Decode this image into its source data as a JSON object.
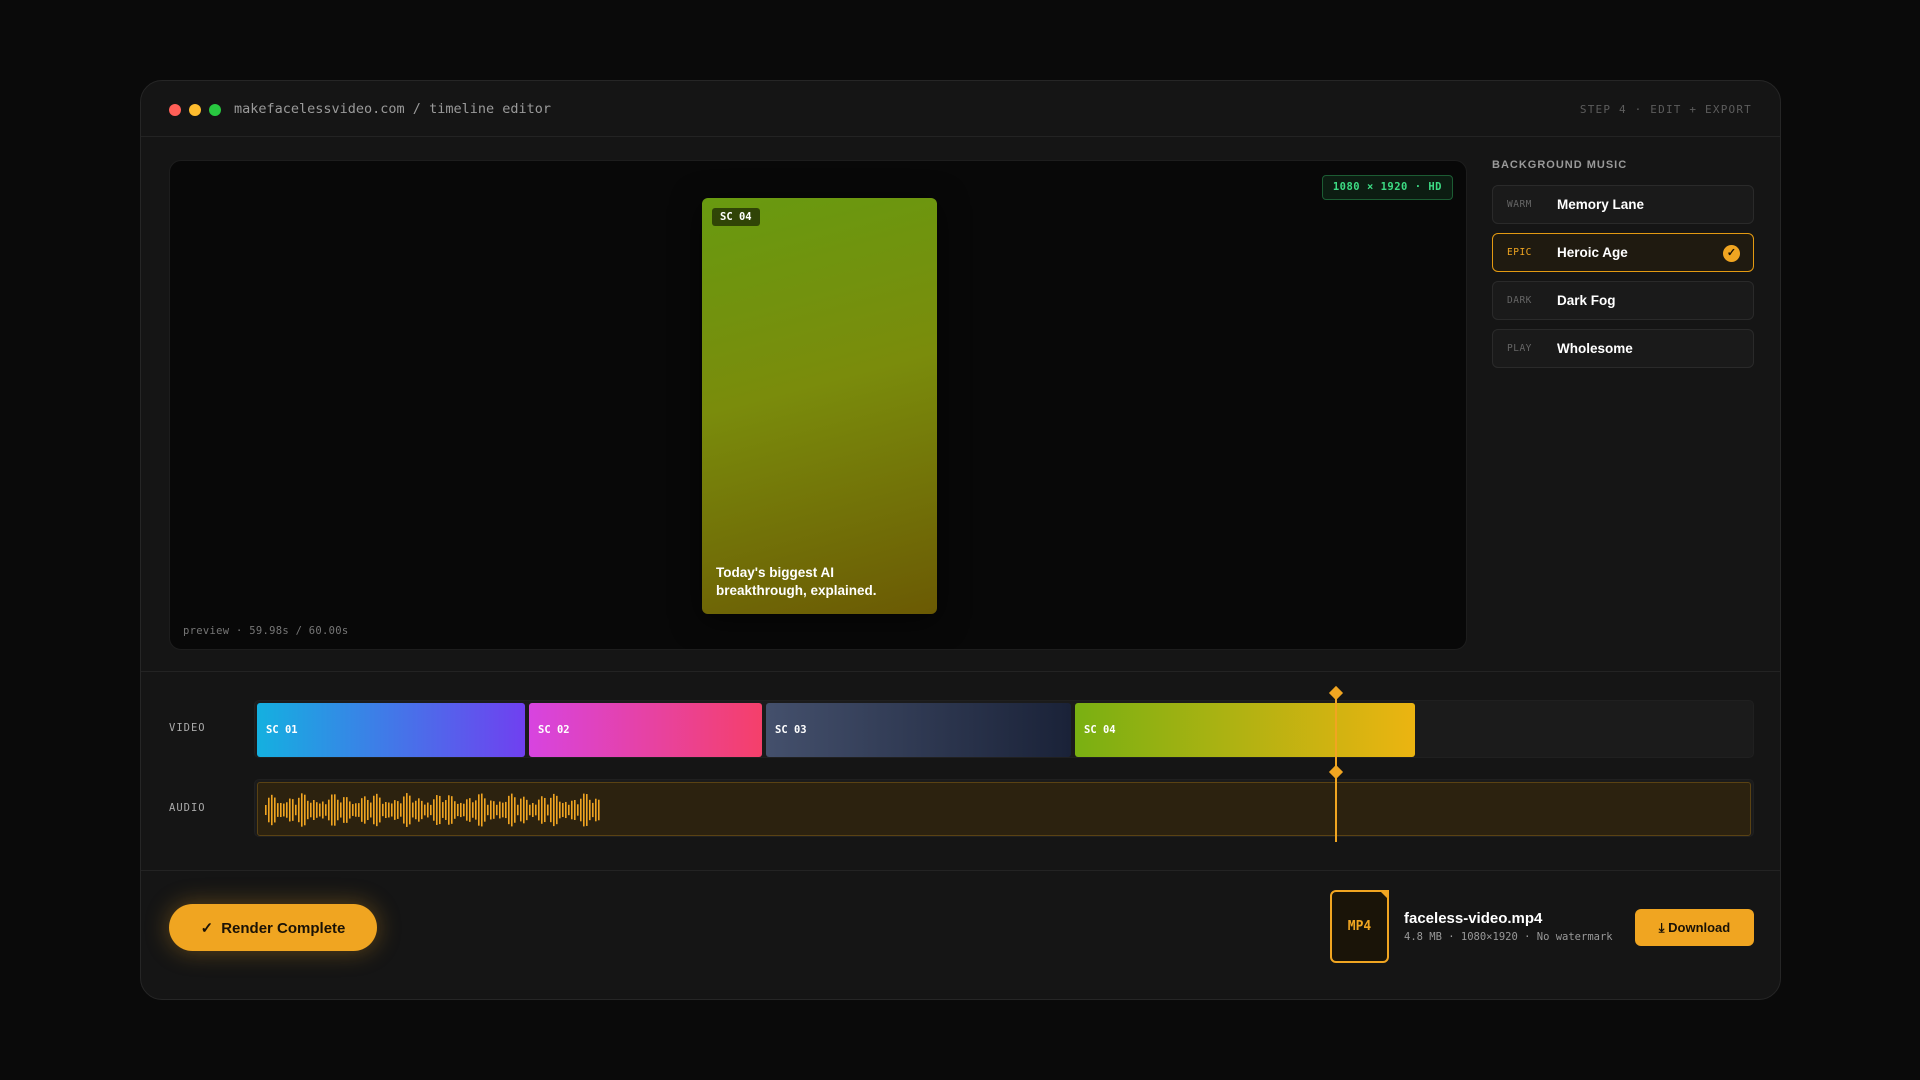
{
  "titlebar": {
    "url": "makefacelessvideo.com / timeline editor",
    "step": "STEP 4 · EDIT + EXPORT"
  },
  "preview": {
    "resolution_badge": "1080 × 1920 · HD",
    "scene_label": "SC 04",
    "caption": "Today's biggest AI breakthrough, explained.",
    "time": "preview · 59.98s / 60.00s"
  },
  "music": {
    "heading": "BACKGROUND MUSIC",
    "tracks": [
      {
        "tag": "WARM",
        "name": "Memory Lane",
        "selected": false
      },
      {
        "tag": "EPIC",
        "name": "Heroic Age",
        "selected": true
      },
      {
        "tag": "DARK",
        "name": "Dark Fog",
        "selected": false
      },
      {
        "tag": "PLAY",
        "name": "Wholesome",
        "selected": false
      }
    ],
    "selected_icon": "check-icon"
  },
  "timeline": {
    "video_label": "VIDEO",
    "audio_label": "AUDIO",
    "clips": [
      {
        "label": "SC 01",
        "colors": [
          "#14b0e0",
          "#7040f0"
        ]
      },
      {
        "label": "SC 02",
        "colors": [
          "#d744e0",
          "#f5406a"
        ]
      },
      {
        "label": "SC 03",
        "colors": [
          "#44506c",
          "#1a2238"
        ]
      },
      {
        "label": "SC 04",
        "colors": [
          "#79b012",
          "#ecb411"
        ]
      }
    ]
  },
  "footer": {
    "render_label": "Render Complete",
    "file_ext": "MP4",
    "file_name": "faceless-video.mp4",
    "file_meta": "4.8 MB · 1080×1920 · No watermark",
    "download_label": "Download"
  },
  "colors": {
    "accent": "#f0a521",
    "badge_green": "#3ddc84",
    "background": "#0a0a0a",
    "window": "#151515"
  }
}
